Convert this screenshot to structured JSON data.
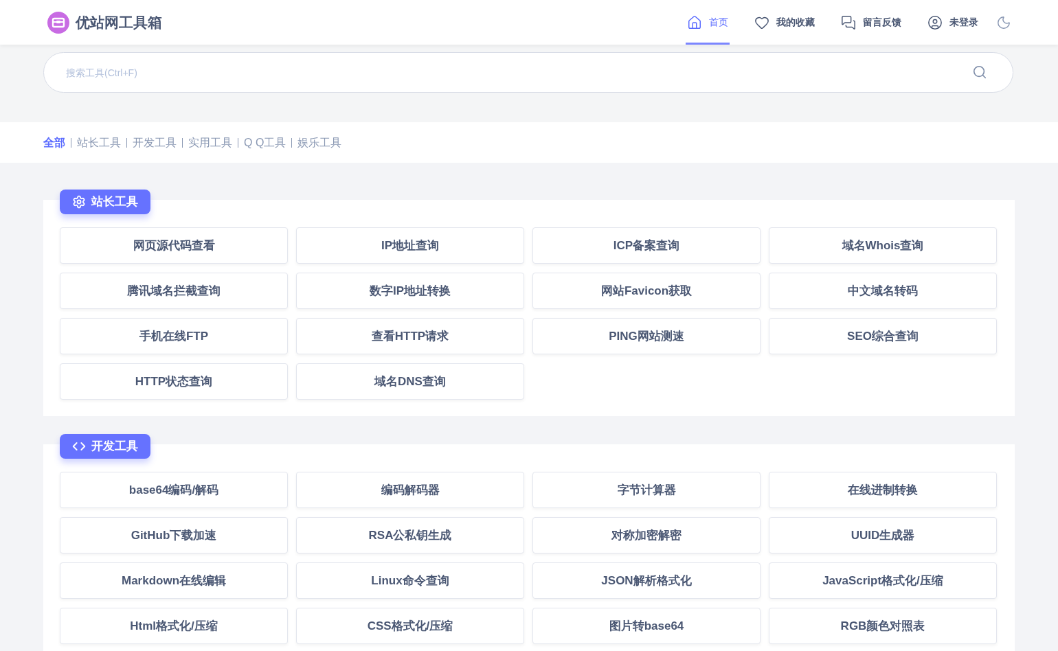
{
  "brand": {
    "name": "优站网工具箱"
  },
  "nav": [
    {
      "kind": "home",
      "label": "首页",
      "selected": true
    },
    {
      "kind": "heart",
      "label": "我的收藏",
      "selected": false
    },
    {
      "kind": "chat",
      "label": "留言反馈",
      "selected": false
    },
    {
      "kind": "user",
      "label": "未登录",
      "selected": false
    }
  ],
  "search": {
    "placeholder": "搜索工具(Ctrl+F)"
  },
  "categories": [
    {
      "label": "全部",
      "selected": true
    },
    {
      "label": "站长工具",
      "selected": false
    },
    {
      "label": "开发工具",
      "selected": false
    },
    {
      "label": "实用工具",
      "selected": false
    },
    {
      "label": "Q Q工具",
      "selected": false
    },
    {
      "label": "娱乐工具",
      "selected": false
    }
  ],
  "sections": [
    {
      "kind": "settings",
      "title": "站长工具",
      "tools": [
        "网页源代码查看",
        "IP地址查询",
        "ICP备案查询",
        "域名Whois查询",
        "腾讯域名拦截查询",
        "数字IP地址转换",
        "网站Favicon获取",
        "中文域名转码",
        "手机在线FTP",
        "查看HTTP请求",
        "PING网站测速",
        "SEO综合查询",
        "HTTP状态查询",
        "域名DNS查询"
      ]
    },
    {
      "kind": "code",
      "title": "开发工具",
      "tools": [
        "base64编码/解码",
        "编码解码器",
        "字节计算器",
        "在线进制转换",
        "GitHub下载加速",
        "RSA公私钥生成",
        "对称加密解密",
        "UUID生成器",
        "Markdown在线编辑",
        "Linux命令查询",
        "JSON解析格式化",
        "JavaScript格式化/压缩",
        "Html格式化/压缩",
        "CSS格式化/压缩",
        "图片转base64",
        "RGB颜色对照表"
      ]
    }
  ]
}
